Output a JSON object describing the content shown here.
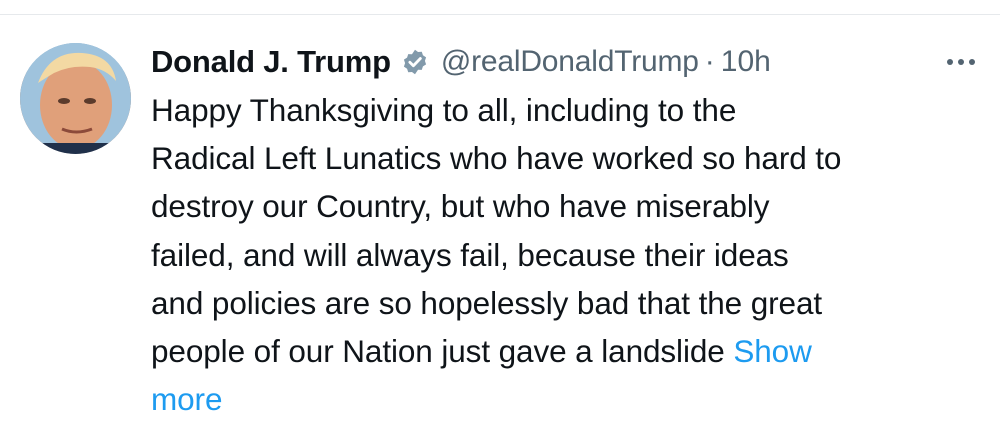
{
  "tweet": {
    "author": {
      "display_name": "Donald J. Trump",
      "handle": "@realDonaldTrump",
      "verified": true,
      "avatar_icon": "profile-photo"
    },
    "separator": "·",
    "timestamp": "10h",
    "text_lines": [
      "Happy Thanksgiving to all, including to the",
      "Radical Left Lunatics who have worked so hard to",
      "destroy our Country, but who have miserably",
      "failed, and will always fail, because their ideas",
      "and policies are so hopelessly bad that the great",
      "people of our Nation just gave a landslide "
    ],
    "show_more_line1": "Show",
    "show_more_line2": "more",
    "more_icon": "ellipsis-icon"
  },
  "colors": {
    "text": "#0f1419",
    "secondary": "#536471",
    "link": "#1d9bf0",
    "verified_badge": "#829aab"
  }
}
